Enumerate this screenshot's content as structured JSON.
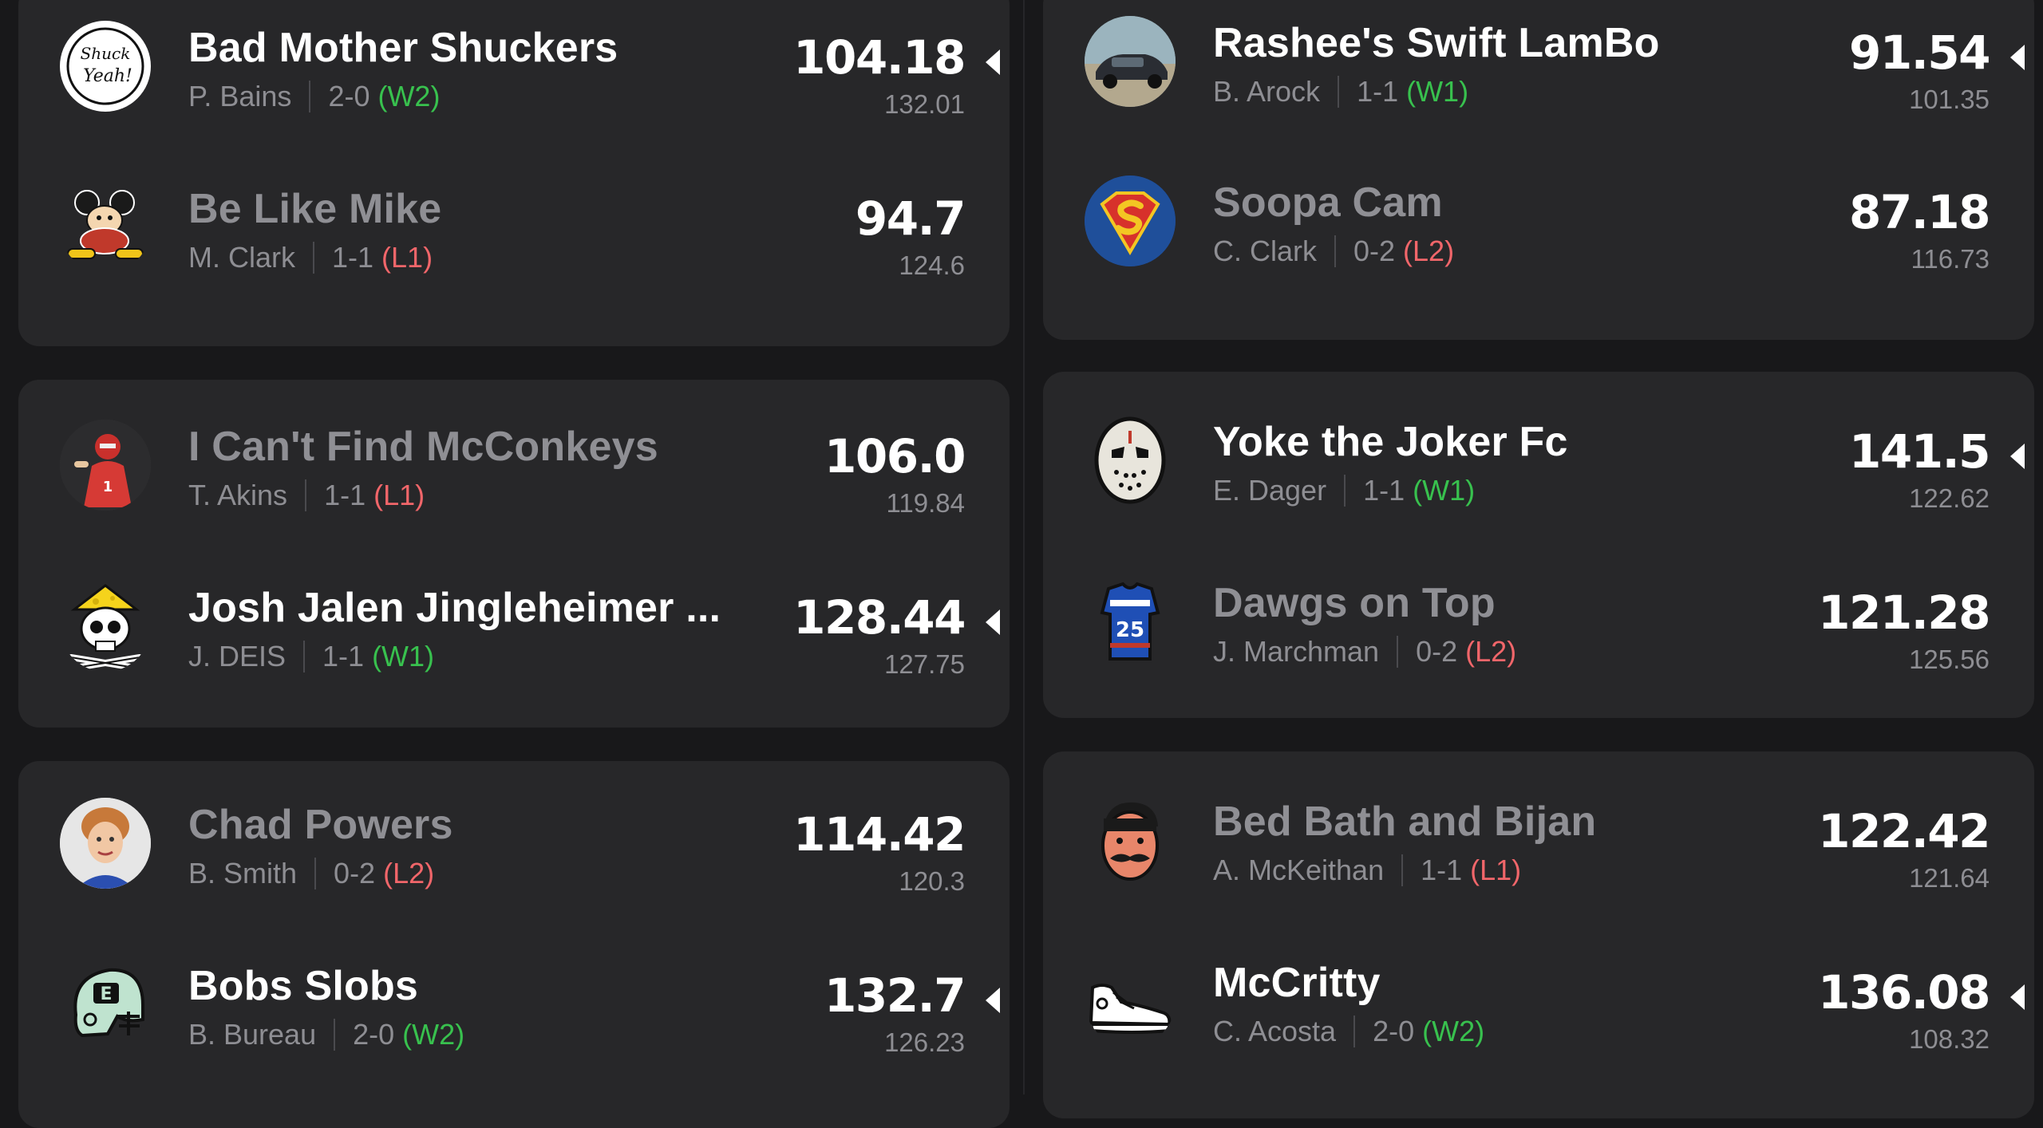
{
  "colors": {
    "background": "#18181a",
    "card": "#272729",
    "winner_name": "#ffffff",
    "loser_name": "#8f8f94",
    "secondary_text": "#8e8e93",
    "win_streak": "#38c14e",
    "loss_streak": "#f1666a"
  },
  "matchups": [
    {
      "teams": [
        {
          "name": "Bad Mother Shuckers",
          "owner": "P. Bains",
          "record": "2-0",
          "streak": "(W2)",
          "score": "104.18",
          "projected": "132.01",
          "winner": true,
          "icon": "shuck-yeah-logo-icon"
        },
        {
          "name": "Be Like Mike",
          "owner": "M. Clark",
          "record": "1-1",
          "streak": "(L1)",
          "score": "94.7",
          "projected": "124.6",
          "winner": false,
          "icon": "cartoon-mouse-icon"
        }
      ]
    },
    {
      "teams": [
        {
          "name": "Rashee's Swift LamBo",
          "owner": "B. Arock",
          "record": "1-1",
          "streak": "(W1)",
          "score": "91.54",
          "projected": "101.35",
          "winner": true,
          "icon": "car-photo-icon"
        },
        {
          "name": "Soopa Cam",
          "owner": "C. Clark",
          "record": "0-2",
          "streak": "(L2)",
          "score": "87.18",
          "projected": "116.73",
          "winner": false,
          "icon": "superhero-shield-icon"
        }
      ]
    },
    {
      "teams": [
        {
          "name": "I Can't Find McConkeys",
          "owner": "T. Akins",
          "record": "1-1",
          "streak": "(L1)",
          "score": "106.0",
          "projected": "119.84",
          "winner": false,
          "icon": "player-photo-icon"
        },
        {
          "name": "Josh Jalen Jingleheimer ...",
          "owner": "J. DEIS",
          "record": "1-1",
          "streak": "(W1)",
          "score": "128.44",
          "projected": "127.75",
          "winner": true,
          "icon": "cheese-skull-icon"
        }
      ]
    },
    {
      "teams": [
        {
          "name": "Yoke the Joker Fc",
          "owner": "E. Dager",
          "record": "1-1",
          "streak": "(W1)",
          "score": "141.5",
          "projected": "122.62",
          "winner": true,
          "icon": "hockey-mask-icon"
        },
        {
          "name": "Dawgs on Top",
          "owner": "J. Marchman",
          "record": "0-2",
          "streak": "(L2)",
          "score": "121.28",
          "projected": "125.56",
          "winner": false,
          "icon": "jersey-25-icon"
        }
      ]
    },
    {
      "teams": [
        {
          "name": "Chad Powers",
          "owner": "B. Smith",
          "record": "0-2",
          "streak": "(L2)",
          "score": "114.42",
          "projected": "120.3",
          "winner": false,
          "icon": "player-face-photo-icon"
        },
        {
          "name": "Bobs Slobs",
          "owner": "B. Bureau",
          "record": "2-0",
          "streak": "(W2)",
          "score": "132.7",
          "projected": "126.23",
          "winner": true,
          "icon": "football-helmet-icon"
        }
      ]
    },
    {
      "teams": [
        {
          "name": "Bed Bath and Bijan",
          "owner": "A. McKeithan",
          "record": "1-1",
          "streak": "(L1)",
          "score": "122.42",
          "projected": "121.64",
          "winner": false,
          "icon": "mustache-face-icon"
        },
        {
          "name": "McCritty",
          "owner": "C. Acosta",
          "record": "2-0",
          "streak": "(W2)",
          "score": "136.08",
          "projected": "108.32",
          "winner": true,
          "icon": "sneaker-icon"
        }
      ]
    }
  ]
}
